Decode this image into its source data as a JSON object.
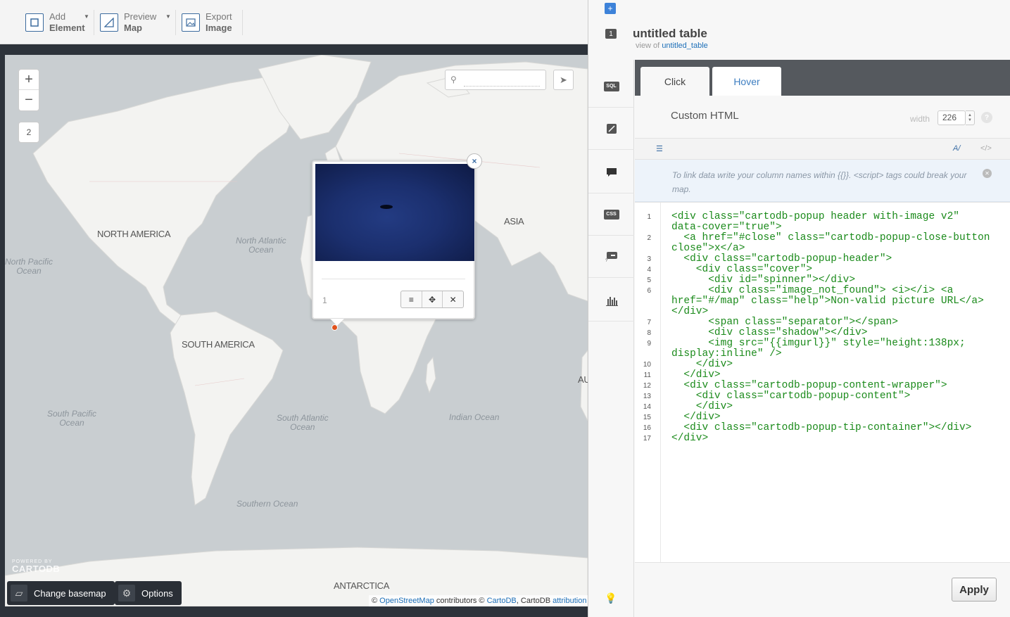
{
  "toolbar": {
    "add_element": {
      "line1": "Add",
      "line2": "Element"
    },
    "preview_map": {
      "line1": "Preview",
      "line2": "Map"
    },
    "export_image": {
      "line1": "Export",
      "line2": "Image"
    }
  },
  "map": {
    "zoom_in": "+",
    "zoom_out": "−",
    "zoom_level": "2",
    "search_placeholder": "",
    "continents": {
      "north_america": "NORTH AMERICA",
      "south_america": "SOUTH AMERICA",
      "asia": "ASIA",
      "antarctica": "ANTARCTICA",
      "au_partial": "AU"
    },
    "oceans": {
      "north_atlantic": [
        "North Atlantic",
        "Ocean"
      ],
      "north_pacific": [
        "North Pacific",
        "Ocean"
      ],
      "south_pacific": [
        "South Pacific",
        "Ocean"
      ],
      "south_atlantic": [
        "South Atlantic",
        "Ocean"
      ],
      "indian": "Indian Ocean",
      "southern": "Southern Ocean"
    },
    "popup": {
      "row_number": "1",
      "close": "×"
    },
    "powered": {
      "line1": "POWERED BY",
      "line2": "CARTODB"
    },
    "change_basemap": "Change basemap",
    "options": "Options",
    "attribution": {
      "prefix": "© ",
      "osm": "OpenStreetMap",
      "mid1": " contributors © ",
      "cartodb": "CartoDB",
      "mid2": ", CartoDB ",
      "attr": "attribution"
    }
  },
  "panel": {
    "add": "+",
    "layer_number": "1",
    "title": "untitled table",
    "view_of_prefix": "view of",
    "view_of_link": "untitled_table",
    "sidebar": [
      "SQL",
      "wizard",
      "infowindow",
      "CSS",
      "legend",
      "filters"
    ],
    "tabs": {
      "click": "Click",
      "hover": "Hover"
    },
    "template_name": "Custom HTML",
    "width_label": "width",
    "width_value": "226",
    "help": "?",
    "editor_left": "☰",
    "editor_right1": "A/",
    "editor_right2": "</>",
    "notice": "To link data write your column names within {{}}. <script> tags could break your map.",
    "apply": "Apply"
  },
  "code_lines": [
    {
      "n": "1",
      "t": "<div class=\"cartodb-popup header with-image v2\""
    },
    {
      "n": "",
      "t": "data-cover=\"true\">"
    },
    {
      "n": "2",
      "t": "  <a href=\"#close\" class=\"cartodb-popup-close-button"
    },
    {
      "n": "",
      "t": "close\">x</a>"
    },
    {
      "n": "3",
      "t": "  <div class=\"cartodb-popup-header\">"
    },
    {
      "n": "4",
      "t": "    <div class=\"cover\">"
    },
    {
      "n": "5",
      "t": "      <div id=\"spinner\"></div>"
    },
    {
      "n": "6",
      "t": "      <div class=\"image_not_found\"> <i></i> <a"
    },
    {
      "n": "",
      "t": "href=\"#/map\" class=\"help\">Non-valid picture URL</a>"
    },
    {
      "n": "",
      "t": "</div>"
    },
    {
      "n": "7",
      "t": "      <span class=\"separator\"></span>"
    },
    {
      "n": "8",
      "t": "      <div class=\"shadow\"></div>"
    },
    {
      "n": "9",
      "t": "      <img src=\"{{imgurl}}\" style=\"height:138px;"
    },
    {
      "n": "",
      "t": "display:inline\" />"
    },
    {
      "n": "10",
      "t": "    </div>"
    },
    {
      "n": "11",
      "t": "  </div>"
    },
    {
      "n": "12",
      "t": "  <div class=\"cartodb-popup-content-wrapper\">"
    },
    {
      "n": "13",
      "t": "    <div class=\"cartodb-popup-content\">"
    },
    {
      "n": "14",
      "t": "    </div>"
    },
    {
      "n": "15",
      "t": "  </div>"
    },
    {
      "n": "16",
      "t": "  <div class=\"cartodb-popup-tip-container\"></div>"
    },
    {
      "n": "17",
      "t": "</div>"
    }
  ],
  "colors": {
    "accent": "#3d82d9",
    "link": "#1d6fb8",
    "marker": "#e0521d",
    "map_water": "#c9ced1",
    "map_land": "#f3f3f1"
  }
}
